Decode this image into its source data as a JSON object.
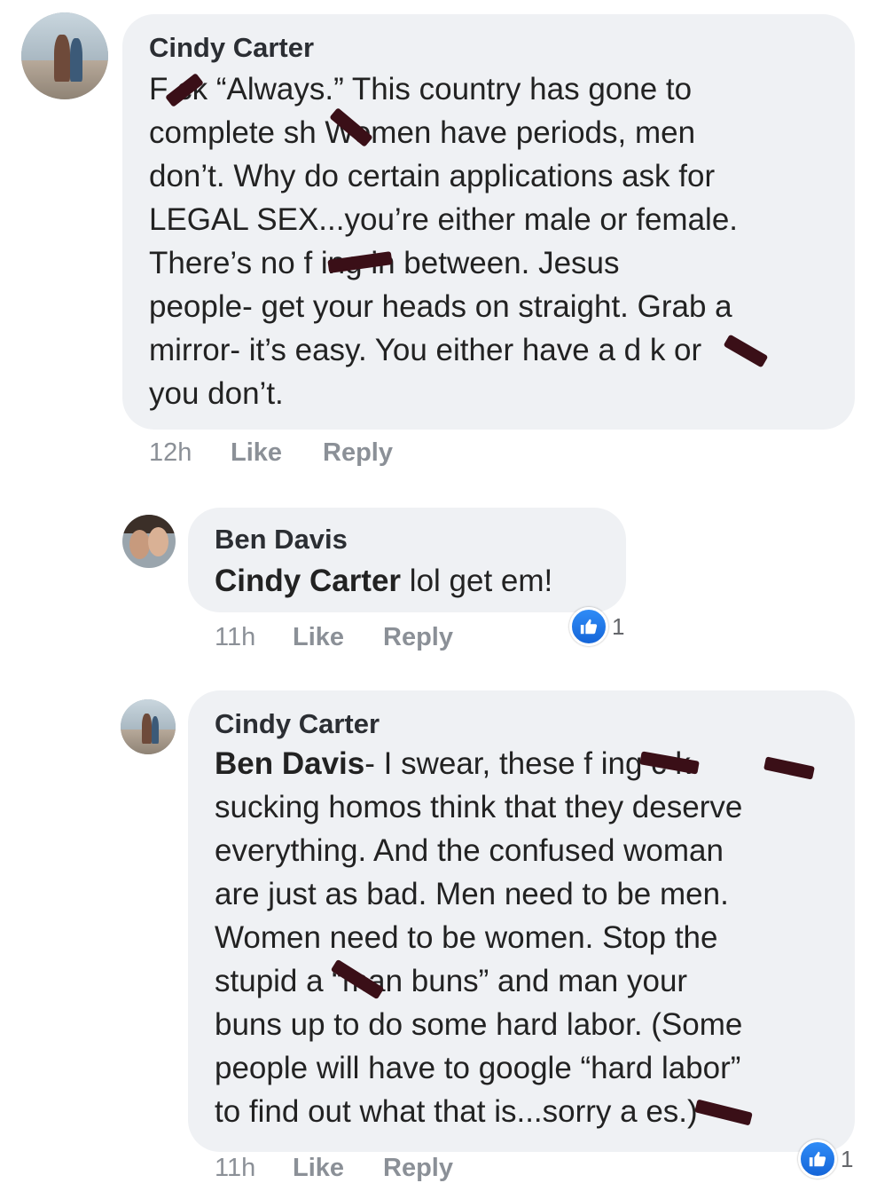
{
  "comments": [
    {
      "author": "Cindy Carter",
      "lines": [
        "F  ck “Always.”  This country has gone to",
        "complete sh      Women have periods, men",
        "don’t.  Why do certain applications ask for",
        "LEGAL SEX...you’re either male or female.",
        "There’s no f       ing in between.  Jesus",
        "people- get your heads on straight.  Grab a",
        "mirror- it’s easy.  You either have a d    k or",
        "you don’t."
      ],
      "time": "12h",
      "like_label": "Like",
      "reply_label": "Reply"
    },
    {
      "author": "Ben Davis",
      "mention": "Cindy Carter",
      "text": " lol get em!",
      "time": "11h",
      "like_label": "Like",
      "reply_label": "Reply",
      "reaction": {
        "icon": "thumbs-up-icon",
        "count": "1",
        "color": "#1877f2"
      }
    },
    {
      "author": "Cindy Carter",
      "mention": "Ben Davis",
      "first_line_rest": "- I swear, these f       ing c     k",
      "lines": [
        "sucking homos think that they deserve",
        "everything.  And the confused woman",
        "are just as bad.  Men need to be men.",
        "Women need to be women.  Stop the",
        "stupid a      “man buns” and man your",
        "buns up to do some hard labor.  (Some",
        "people will have to google “hard labor”",
        "to find out what that is...sorry a       es.)"
      ],
      "time": "11h",
      "like_label": "Like",
      "reply_label": "Reply",
      "reaction": {
        "icon": "thumbs-up-icon",
        "count": "1",
        "color": "#1877f2"
      }
    }
  ],
  "colors": {
    "bubble": "#eff1f4",
    "redaction": "#3a0f17",
    "meta_text": "#8b9097"
  }
}
